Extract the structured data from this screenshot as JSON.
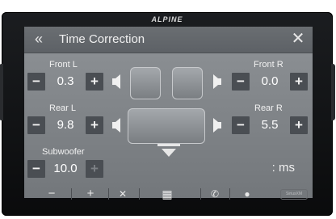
{
  "brand": "ALPINE",
  "header": {
    "title": "Time Correction",
    "back_icon": "double-chevron-left-icon",
    "close_icon": "close-icon"
  },
  "channels": {
    "front_l": {
      "label": "Front L",
      "value": "0.3"
    },
    "front_r": {
      "label": "Front R",
      "value": "0.0"
    },
    "rear_l": {
      "label": "Rear L",
      "value": "9.8"
    },
    "rear_r": {
      "label": "Rear R",
      "value": "5.5"
    },
    "subwoofer": {
      "label": "Subwoofer",
      "value": "10.0"
    }
  },
  "buttons": {
    "minus": "−",
    "plus": "+"
  },
  "unit": ": ms",
  "bottom_bar": {
    "vol_down": "−",
    "vol_up": "+",
    "badge": "SiriusXM"
  },
  "colors": {
    "panel": "#7d8185",
    "button": "#4a4e53",
    "title_bar": "#62666a"
  }
}
